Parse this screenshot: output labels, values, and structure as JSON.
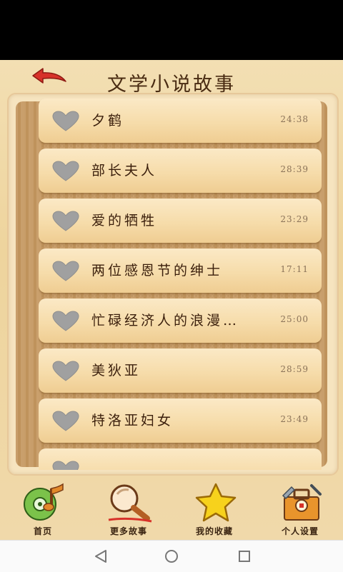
{
  "header": {
    "title": "文学小说故事",
    "back_icon": "back-arrow-icon"
  },
  "stories": [
    {
      "title": "夕鹤",
      "duration": "24:38"
    },
    {
      "title": "部长夫人",
      "duration": "28:39"
    },
    {
      "title": "爱的牺牲",
      "duration": "23:29"
    },
    {
      "title": "两位感恩节的绅士",
      "duration": "17:11"
    },
    {
      "title": "忙碌经济人的浪漫…",
      "duration": "25:00"
    },
    {
      "title": "美狄亚",
      "duration": "28:59"
    },
    {
      "title": "特洛亚妇女",
      "duration": "23:49"
    },
    {
      "title": "",
      "duration": ""
    }
  ],
  "tabs": [
    {
      "label": "首页",
      "icon": "home-music-icon"
    },
    {
      "label": "更多故事",
      "icon": "magnifier-icon"
    },
    {
      "label": "我的收藏",
      "icon": "star-icon"
    },
    {
      "label": "个人设置",
      "icon": "settings-toolbox-icon"
    }
  ],
  "nav": {
    "back": "back-triangle-icon",
    "home": "home-circle-icon",
    "recent": "recents-square-icon"
  },
  "colors": {
    "heart": "#a0a0a0",
    "title_text": "#4a2c13",
    "accent_red": "#d7322a"
  }
}
